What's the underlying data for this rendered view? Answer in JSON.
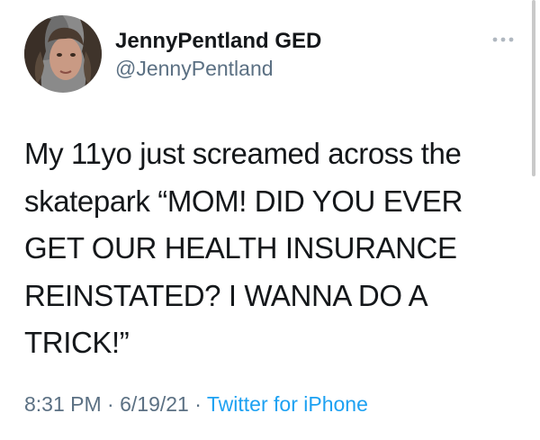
{
  "user": {
    "display_name": "JennyPentland GED",
    "handle": "@JennyPentland"
  },
  "tweet": {
    "text": "My 11yo just screamed across the\nskatepark “MOM! DID YOU EVER\nGET OUR HEALTH INSURANCE\nREINSTATED? I WANNA DO A\nTRICK!”"
  },
  "meta": {
    "time": "8:31 PM",
    "separator": " · ",
    "date": "6/19/21",
    "source": "Twitter for iPhone"
  },
  "icons": {
    "more": "more-options-icon",
    "avatar": "profile-avatar"
  },
  "colors": {
    "text": "#14171a",
    "secondary": "#5b7083",
    "link": "#1da1f2"
  }
}
